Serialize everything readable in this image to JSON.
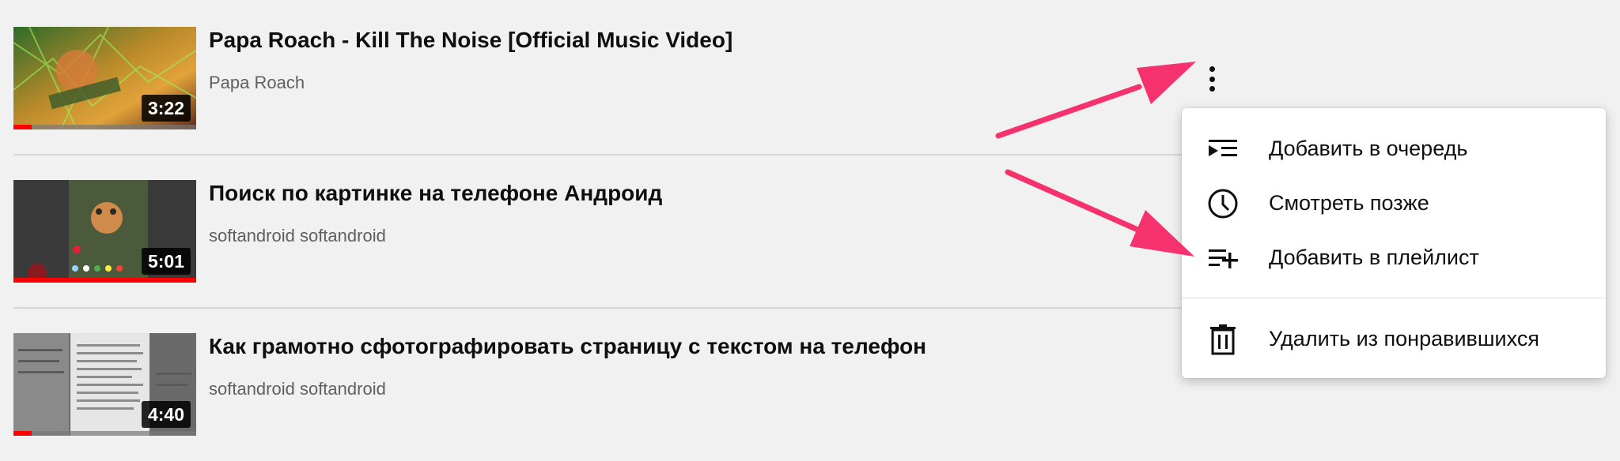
{
  "videos": [
    {
      "title": "Papa Roach - Kill The Noise [Official Music Video]",
      "channel": "Papa Roach",
      "duration": "3:22",
      "watched_fraction": 0.1
    },
    {
      "title": "Поиск по картинке на телефоне Андроид",
      "channel": "softandroid softandroid",
      "duration": "5:01",
      "watched_fraction": 1.0
    },
    {
      "title": "Как грамотно сфотографировать страницу с текстом на телефон",
      "channel": "softandroid softandroid",
      "duration": "4:40",
      "watched_fraction": 0.1
    }
  ],
  "context_menu": {
    "items": [
      {
        "label": "Добавить в очередь",
        "icon": "add-to-queue-icon"
      },
      {
        "label": "Смотреть позже",
        "icon": "clock-icon"
      },
      {
        "label": "Добавить в плейлист",
        "icon": "playlist-add-icon"
      }
    ],
    "danger_items": [
      {
        "label": "Удалить из понравившихся",
        "icon": "trash-icon"
      }
    ]
  },
  "colors": {
    "background": "#f1f1f1",
    "progress_red": "#ff0000",
    "annotation_arrow": "#f5326e",
    "text_primary": "#0f0f0f",
    "text_secondary": "#606060"
  }
}
